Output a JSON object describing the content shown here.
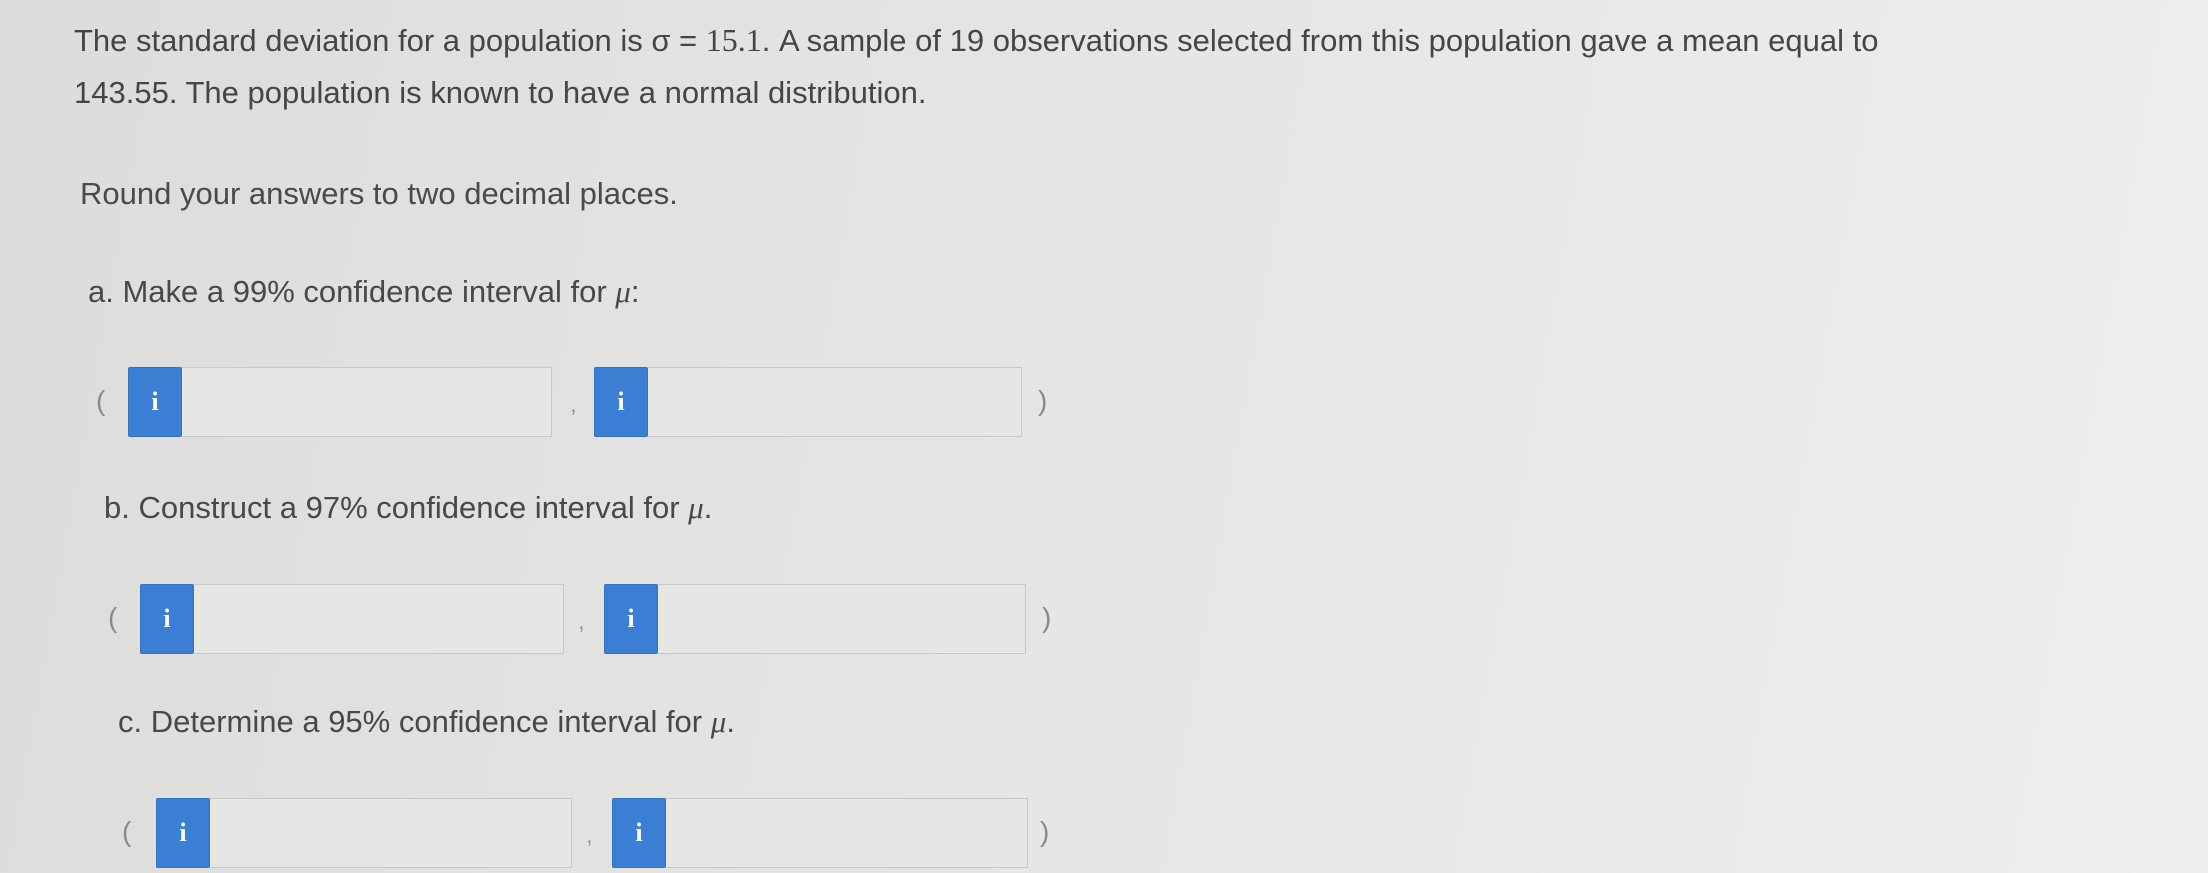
{
  "question": {
    "line1_pre": "The standard deviation for a population is σ = ",
    "sigma_value": "15.1",
    "line1_mid": ". A sample of ",
    "sample_size": "19",
    "line1_post": " observations selected from this population gave a mean equal to",
    "line2": "143.55. The population is known to have a normal distribution."
  },
  "instructions": "Round your answers to two decimal places.",
  "parts": [
    {
      "label": "a. Make a 99% confidence interval for ",
      "mu": "μ",
      "punct": ":",
      "open_paren": "(",
      "comma": ",",
      "close_paren": ")",
      "info_icon": "i",
      "lower_value": "",
      "upper_value": ""
    },
    {
      "label": "b. Construct a 97% confidence interval for ",
      "mu": "μ",
      "punct": ".",
      "open_paren": "(",
      "comma": ",",
      "close_paren": ")",
      "info_icon": "i",
      "lower_value": "",
      "upper_value": ""
    },
    {
      "label": "c. Determine a 95% confidence interval for ",
      "mu": "μ",
      "punct": ".",
      "open_paren": "(",
      "comma": ",",
      "close_paren": ")",
      "info_icon": "i",
      "lower_value": "",
      "upper_value": ""
    }
  ],
  "icons": {
    "info": "info-icon"
  },
  "colors": {
    "info_button": "#3b7fd4",
    "text": "#484848",
    "background": "#e3e3e1"
  }
}
